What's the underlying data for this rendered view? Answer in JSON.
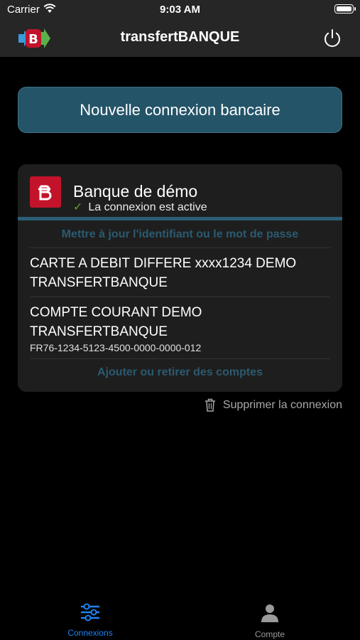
{
  "status_bar": {
    "carrier": "Carrier",
    "time": "9:03 AM"
  },
  "nav": {
    "title": "transfertBANQUE"
  },
  "main": {
    "new_connection_button": "Nouvelle connexion bancaire",
    "bank": {
      "name": "Banque de démo",
      "status": "La connexion est active",
      "update_credentials_link": "Mettre à jour l'identifiant ou le mot de passe",
      "accounts": [
        {
          "name": "CARTE A DEBIT DIFFERE xxxx1234 DEMO TRANSFERTBANQUE"
        },
        {
          "name": "COMPTE COURANT DEMO TRANSFERTBANQUE",
          "iban": "FR76-1234-5123-4500-0000-0000-012"
        }
      ],
      "manage_accounts_link": "Ajouter ou retirer des comptes"
    },
    "delete_connection": "Supprimer la connexion"
  },
  "tabs": [
    {
      "label": "Connexions",
      "icon": "sliders-icon",
      "active": true,
      "color": "#1f83f0"
    },
    {
      "label": "Compte",
      "icon": "person-icon",
      "active": false,
      "color": "#9a9a9a"
    }
  ],
  "colors": {
    "accent": "#1f83f0",
    "brand_red": "#c3132b",
    "button_bg": "#245468",
    "link_text": "#2b5a70",
    "status_check": "#6a9a2f"
  }
}
